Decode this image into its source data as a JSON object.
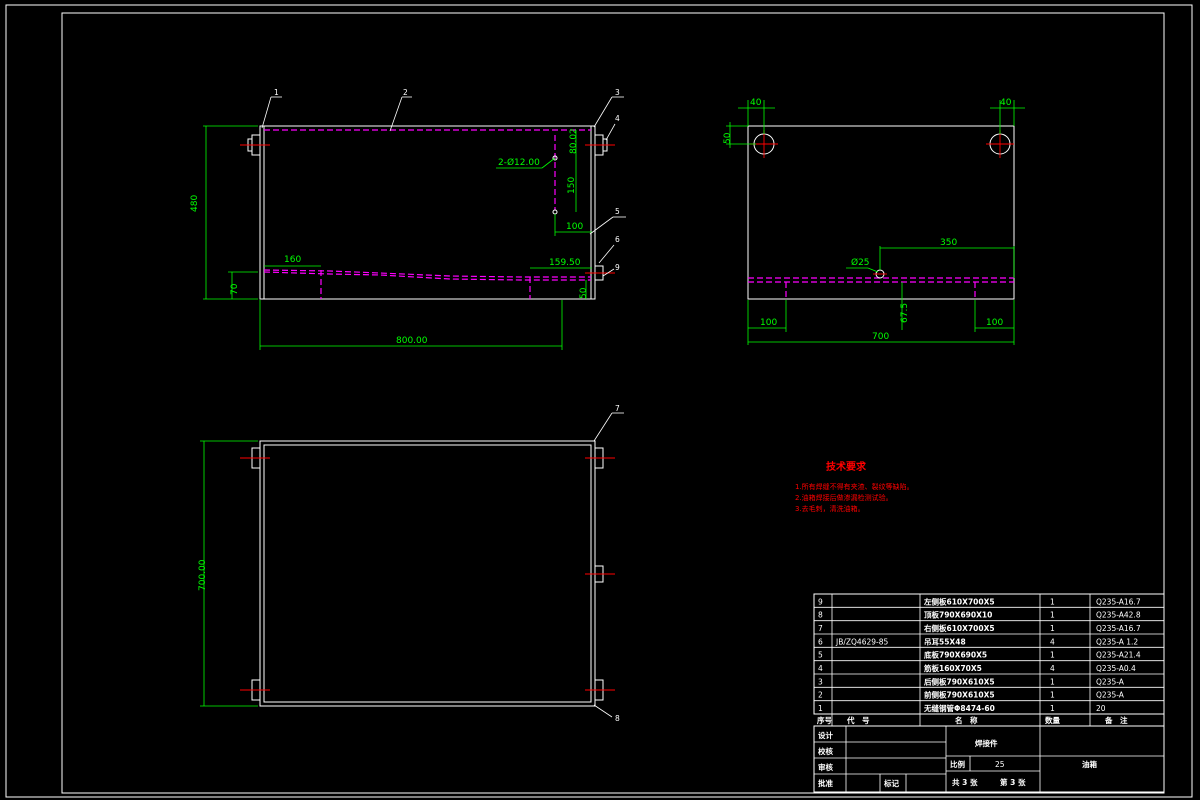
{
  "colors": {
    "background": "#000000",
    "outline": "#ffffff",
    "dimension": "#00ff00",
    "hidden_line": "#ff00ff",
    "centerline": "#ff0000",
    "notes": "#ff0000"
  },
  "front_view": {
    "part_labels": [
      "1",
      "2",
      "3",
      "4",
      "5",
      "6",
      "9"
    ],
    "hole_callout": "2-Ø12.00",
    "dims": {
      "height": "480",
      "width": "800.00",
      "bottom_offset": "70",
      "left_offset": "160",
      "right_offset": "159.50",
      "bottom_right": "50",
      "hole_vertical_a": "80.02",
      "hole_vertical_b": "150",
      "hole_horizontal": "100"
    }
  },
  "side_view": {
    "dims": {
      "left_hole": "40",
      "right_hole": "40",
      "hole_top": "50",
      "span": "350",
      "diameter": "Ø25",
      "height_small": "67.5",
      "left_bottom": "100",
      "right_bottom": "100",
      "total_width": "700"
    }
  },
  "top_view": {
    "part_labels": [
      "7",
      "8"
    ],
    "dims": {
      "depth": "700.00"
    }
  },
  "tech_notes": {
    "title": "技术要求",
    "lines": [
      "1.所有焊缝不得有夹渣、裂纹等缺陷。",
      "2.油箱焊接后做渗漏检测试验。",
      "3.去毛刺，清洗油箱。"
    ]
  },
  "bom": {
    "rows": [
      {
        "no": "9",
        "code": "",
        "name": "左侧板610X700X5",
        "qty": "1",
        "material": "Q235-A16.7"
      },
      {
        "no": "8",
        "code": "",
        "name": "顶板790X690X10",
        "qty": "1",
        "material": "Q235-A42.8"
      },
      {
        "no": "7",
        "code": "",
        "name": "右侧板610X700X5",
        "qty": "1",
        "material": "Q235-A16.7"
      },
      {
        "no": "6",
        "code": "JB/ZQ4629-85",
        "name": "吊耳55X48",
        "qty": "4",
        "material": "Q235-A 1.2"
      },
      {
        "no": "5",
        "code": "",
        "name": "底板790X690X5",
        "qty": "1",
        "material": "Q235-A21.4"
      },
      {
        "no": "4",
        "code": "",
        "name": "筋板160X70X5",
        "qty": "4",
        "material": "Q235-A0.4"
      },
      {
        "no": "3",
        "code": "",
        "name": "后侧板790X610X5",
        "qty": "1",
        "material": "Q235-A"
      },
      {
        "no": "2",
        "code": "",
        "name": "前侧板790X610X5",
        "qty": "1",
        "material": "Q235-A"
      },
      {
        "no": "1",
        "code": "",
        "name": "无缝钢管Φ8474-60",
        "qty": "1",
        "material": "20"
      }
    ],
    "header": {
      "no": "序号",
      "code": "代　号",
      "name": "名　称",
      "qty": "数量",
      "remark": "备　注"
    }
  },
  "title_block": {
    "design": "设计",
    "check": "校核",
    "review": "审核",
    "approve": "批准",
    "part_name": "焊接件",
    "scale_label": "比例",
    "scale_value": "25",
    "drawing_name": "油箱",
    "sheet_total": "共 3 张",
    "sheet_current": "第 3 张",
    "mark": "标记"
  }
}
